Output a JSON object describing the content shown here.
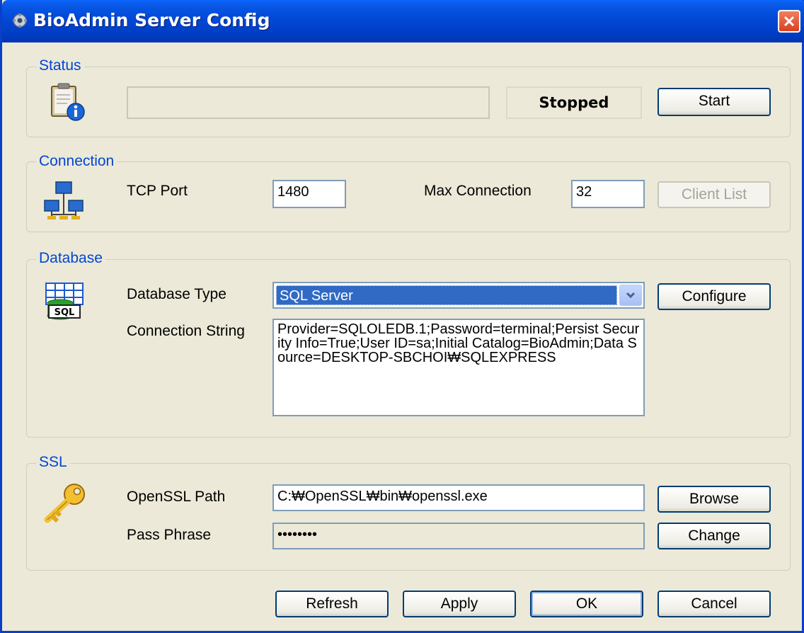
{
  "window": {
    "title": "BioAdmin Server Config",
    "icon": "gear-icon",
    "close_icon": "close-icon"
  },
  "status": {
    "group_label": "Status",
    "icon": "clipboard-info-icon",
    "progress_text": "",
    "state": "Stopped",
    "start_label": "Start"
  },
  "connection": {
    "group_label": "Connection",
    "icon": "network-icon",
    "tcp_port_label": "TCP Port",
    "tcp_port_value": "1480",
    "max_connection_label": "Max Connection",
    "max_connection_value": "32",
    "client_list_label": "Client List"
  },
  "database": {
    "group_label": "Database",
    "icon": "sql-database-icon",
    "type_label": "Database Type",
    "type_value": "SQL Server",
    "configure_label": "Configure",
    "connection_string_label": "Connection String",
    "connection_string_value": "Provider=SQLOLEDB.1;Password=terminal;Persist Security Info=True;User ID=sa;Initial Catalog=BioAdmin;Data Source=DESKTOP-SBCHOI₩SQLEXPRESS"
  },
  "ssl": {
    "group_label": "SSL",
    "icon": "key-icon",
    "openssl_path_label": "OpenSSL Path",
    "openssl_path_value": "C:₩OpenSSL₩bin₩openssl.exe",
    "browse_label": "Browse",
    "pass_phrase_label": "Pass Phrase",
    "pass_phrase_value": "••••••••",
    "change_label": "Change"
  },
  "footer": {
    "refresh_label": "Refresh",
    "apply_label": "Apply",
    "ok_label": "OK",
    "cancel_label": "Cancel"
  },
  "colors": {
    "titlebar": "#0148d6",
    "window_bg": "#ece9d8",
    "group_label": "#0046d5",
    "selection": "#316ac5"
  }
}
